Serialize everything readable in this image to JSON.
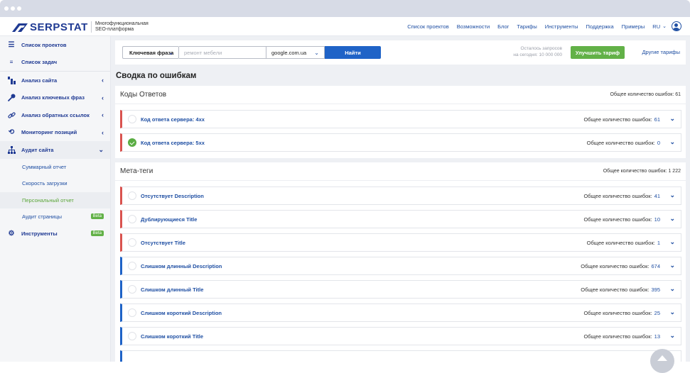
{
  "brand": {
    "name": "SERPSTAT",
    "tagline_line1": "Многофункциональная",
    "tagline_line2": "SEO-платформа"
  },
  "topnav": {
    "items": [
      "Список проектов",
      "Возможности",
      "Блог",
      "Тарифы",
      "Инструменты",
      "Поддержка",
      "Примеры"
    ],
    "lang": "RU"
  },
  "sidebar": {
    "items": [
      {
        "label": "Список проектов",
        "icon": "list-icon"
      },
      {
        "label": "Список задач",
        "icon": "tasks-icon"
      },
      {
        "label": "Анализ сайта",
        "icon": "site-analysis-icon"
      },
      {
        "label": "Анализ ключевых фраз",
        "icon": "key-icon"
      },
      {
        "label": "Анализ обратных ссылок",
        "icon": "link-icon"
      },
      {
        "label": "Мониторинг позиций",
        "icon": "history-icon"
      },
      {
        "label": "Аудит сайта",
        "icon": "sitemap-icon"
      }
    ],
    "audit_sub": [
      {
        "label": "Суммарный отчет"
      },
      {
        "label": "Скорость загрузки"
      },
      {
        "label": "Персональный отчет"
      },
      {
        "label": "Аудит страницы",
        "badge": "Beta"
      }
    ],
    "tools": {
      "label": "Инструменты",
      "badge": "Beta",
      "icon": "gear-icon"
    }
  },
  "search": {
    "mode": "Ключевая фраза",
    "placeholder": "ремонт мебели",
    "database": "google.com.ua",
    "submit": "Найти",
    "limits_line1": "Осталось запросов",
    "limits_line2": "на сегодня: 10 000 000",
    "upgrade": "Улучшить тариф",
    "other_tariffs": "Другие тарифы"
  },
  "page_title": "Сводка по ошибкам",
  "count_label": "Общее количество ошибок:",
  "sections": [
    {
      "title": "Коды Ответов",
      "total_label": "Общее количество ошибок: 61",
      "rows": [
        {
          "label": "Код ответа сервера: 4xx",
          "count": "61",
          "status": "empty",
          "severity": "red"
        },
        {
          "label": "Код ответа сервера: 5xx",
          "count": "0",
          "status": "ok",
          "severity": "red"
        }
      ]
    },
    {
      "title": "Мета-теги",
      "total_label": "Общее количество ошибок: 1 222",
      "rows": [
        {
          "label": "Отсутствует Description",
          "count": "41",
          "severity": "red"
        },
        {
          "label": "Дублирующиеся Title",
          "count": "10",
          "severity": "red"
        },
        {
          "label": "Отсутствует Title",
          "count": "1",
          "severity": "red"
        },
        {
          "label": "Слишком длинный Description",
          "count": "674",
          "severity": "blue"
        },
        {
          "label": "Слишком длинный Title",
          "count": "395",
          "severity": "blue"
        },
        {
          "label": "Слишком короткий Description",
          "count": "25",
          "severity": "blue"
        },
        {
          "label": "Слишком короткий Title",
          "count": "13",
          "severity": "blue"
        }
      ]
    }
  ],
  "colors": {
    "brand": "#1f3a93",
    "link": "#1f4fa3",
    "accent_green": "#62b147",
    "error_red": "#d9534f",
    "warning_blue": "#1f63c7"
  }
}
